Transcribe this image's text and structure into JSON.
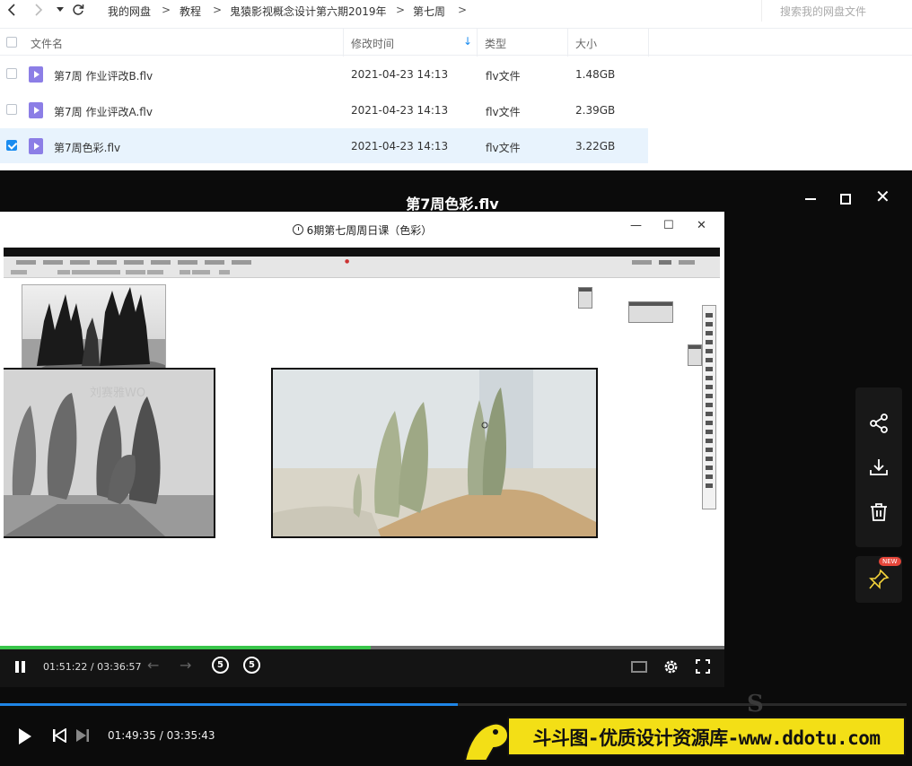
{
  "nav": {
    "back_icon": "chevron-left-icon",
    "forward_icon": "chevron-right-icon",
    "history_icon": "dropdown-icon",
    "refresh_icon": "refresh-icon",
    "breadcrumb": [
      "我的网盘",
      "教程",
      "鬼猿影视概念设计第六期2019年",
      "第七周"
    ],
    "separator": ">",
    "search_placeholder": "搜索我的网盘文件"
  },
  "table": {
    "columns": [
      "文件名",
      "修改时间",
      "类型",
      "大小"
    ],
    "sort_icon": "arrow-down-icon",
    "rows": [
      {
        "name": "第7周  作业评改B.flv",
        "modified": "2021-04-23 14:13",
        "type": "flv文件",
        "size": "1.48GB",
        "checked": false
      },
      {
        "name": "第7周 作业评改A.flv",
        "modified": "2021-04-23 14:13",
        "type": "flv文件",
        "size": "2.39GB",
        "checked": false
      },
      {
        "name": "第7周色彩.flv",
        "modified": "2021-04-23 14:13",
        "type": "flv文件",
        "size": "3.22GB",
        "checked": true
      }
    ]
  },
  "player": {
    "title": "第7周色彩.flv",
    "window_controls": [
      "minimize-icon",
      "maximize-icon",
      "close-icon"
    ],
    "inner_window": {
      "title": "6期第七周周日课（色彩）",
      "window_controls": [
        "—",
        "☐",
        "✕"
      ],
      "watermark": "刘赛雅WO",
      "progress_fraction": 0.512,
      "current_time": "01:51:22",
      "total_time": "03:36:57",
      "rewind_label": "5",
      "forward_label": "5"
    },
    "side_actions": [
      "share-icon",
      "download-icon",
      "delete-icon"
    ],
    "pin_badge": "NEW",
    "progress_fraction": 0.505,
    "current_time": "01:49:35",
    "total_time": "03:35:43",
    "time_separator": "/"
  },
  "watermark_banner": "斗斗图-优质设计资源库-www.ddotu.com"
}
